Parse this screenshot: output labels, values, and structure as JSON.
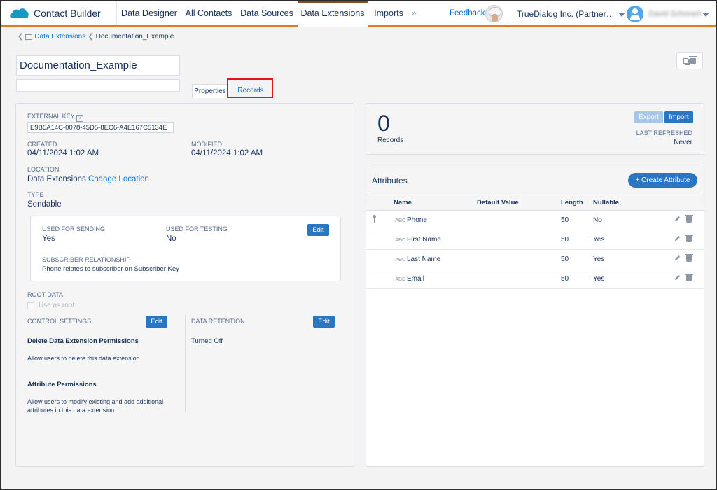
{
  "nav": {
    "brand": "Contact Builder",
    "tabs": [
      {
        "label": "Data Designer"
      },
      {
        "label": "All Contacts"
      },
      {
        "label": "Data Sources"
      },
      {
        "label": "Data Extensions"
      },
      {
        "label": "Imports"
      }
    ],
    "more": "»",
    "feedback": "Feedback",
    "org": "TrueDialog Inc. (Partner…",
    "user": "David Schonert"
  },
  "breadcrumb": {
    "root": "Data Extensions",
    "current": "Documentation_Example"
  },
  "header": {
    "name": "Documentation_Example",
    "description": ""
  },
  "tabs": {
    "properties": "Properties",
    "records": "Records"
  },
  "properties": {
    "external_key_label": "EXTERNAL KEY",
    "external_key": "E9B5A14C-0078-45D5-8EC6-A4E167C5134E",
    "created_label": "CREATED",
    "created": "04/11/2024 1:02 AM",
    "modified_label": "MODIFIED",
    "modified": "04/11/2024 1:02 AM",
    "location_label": "LOCATION",
    "location": "Data Extensions",
    "change_location": "Change Location",
    "type_label": "TYPE",
    "type": "Sendable",
    "used_for_sending_label": "USED FOR SENDING",
    "used_for_sending": "Yes",
    "used_for_testing_label": "USED FOR TESTING",
    "used_for_testing": "No",
    "edit": "Edit",
    "subscriber_relationship_label": "SUBSCRIBER RELATIONSHIP",
    "subscriber_relationship": "Phone relates to subscriber on Subscriber Key",
    "root_data_label": "ROOT DATA",
    "use_as_root": "Use as root",
    "control_settings_label": "CONTROL SETTINGS",
    "data_retention_label": "DATA RETENTION",
    "data_retention": "Turned Off",
    "delete_perm_title": "Delete Data Extension Permissions",
    "delete_perm_desc": "Allow users to delete this data extension",
    "attr_perm_title": "Attribute Permissions",
    "attr_perm_desc_1": "Allow users to modify existing and add additional",
    "attr_perm_desc_2": "attributes in this data extension"
  },
  "records": {
    "count": "0",
    "count_label": "Records",
    "export": "Export",
    "import": "Import",
    "last_refreshed_label": "LAST REFRESHED",
    "last_refreshed": "Never"
  },
  "attributes": {
    "title": "Attributes",
    "create": "+   Create Attribute",
    "columns": {
      "name": "Name",
      "default": "Default Value",
      "length": "Length",
      "nullable": "Nullable"
    },
    "type_tag": "ABC",
    "rows": [
      {
        "name": "Phone",
        "default": "",
        "length": "50",
        "nullable": "No"
      },
      {
        "name": "First Name",
        "default": "",
        "length": "50",
        "nullable": "Yes"
      },
      {
        "name": "Last Name",
        "default": "",
        "length": "50",
        "nullable": "Yes"
      },
      {
        "name": "Email",
        "default": "",
        "length": "50",
        "nullable": "Yes"
      }
    ]
  },
  "colors": {
    "accent": "#e07b16",
    "primary_button": "#2a76c2",
    "link": "#0070d2",
    "highlight": "#e0161e"
  }
}
